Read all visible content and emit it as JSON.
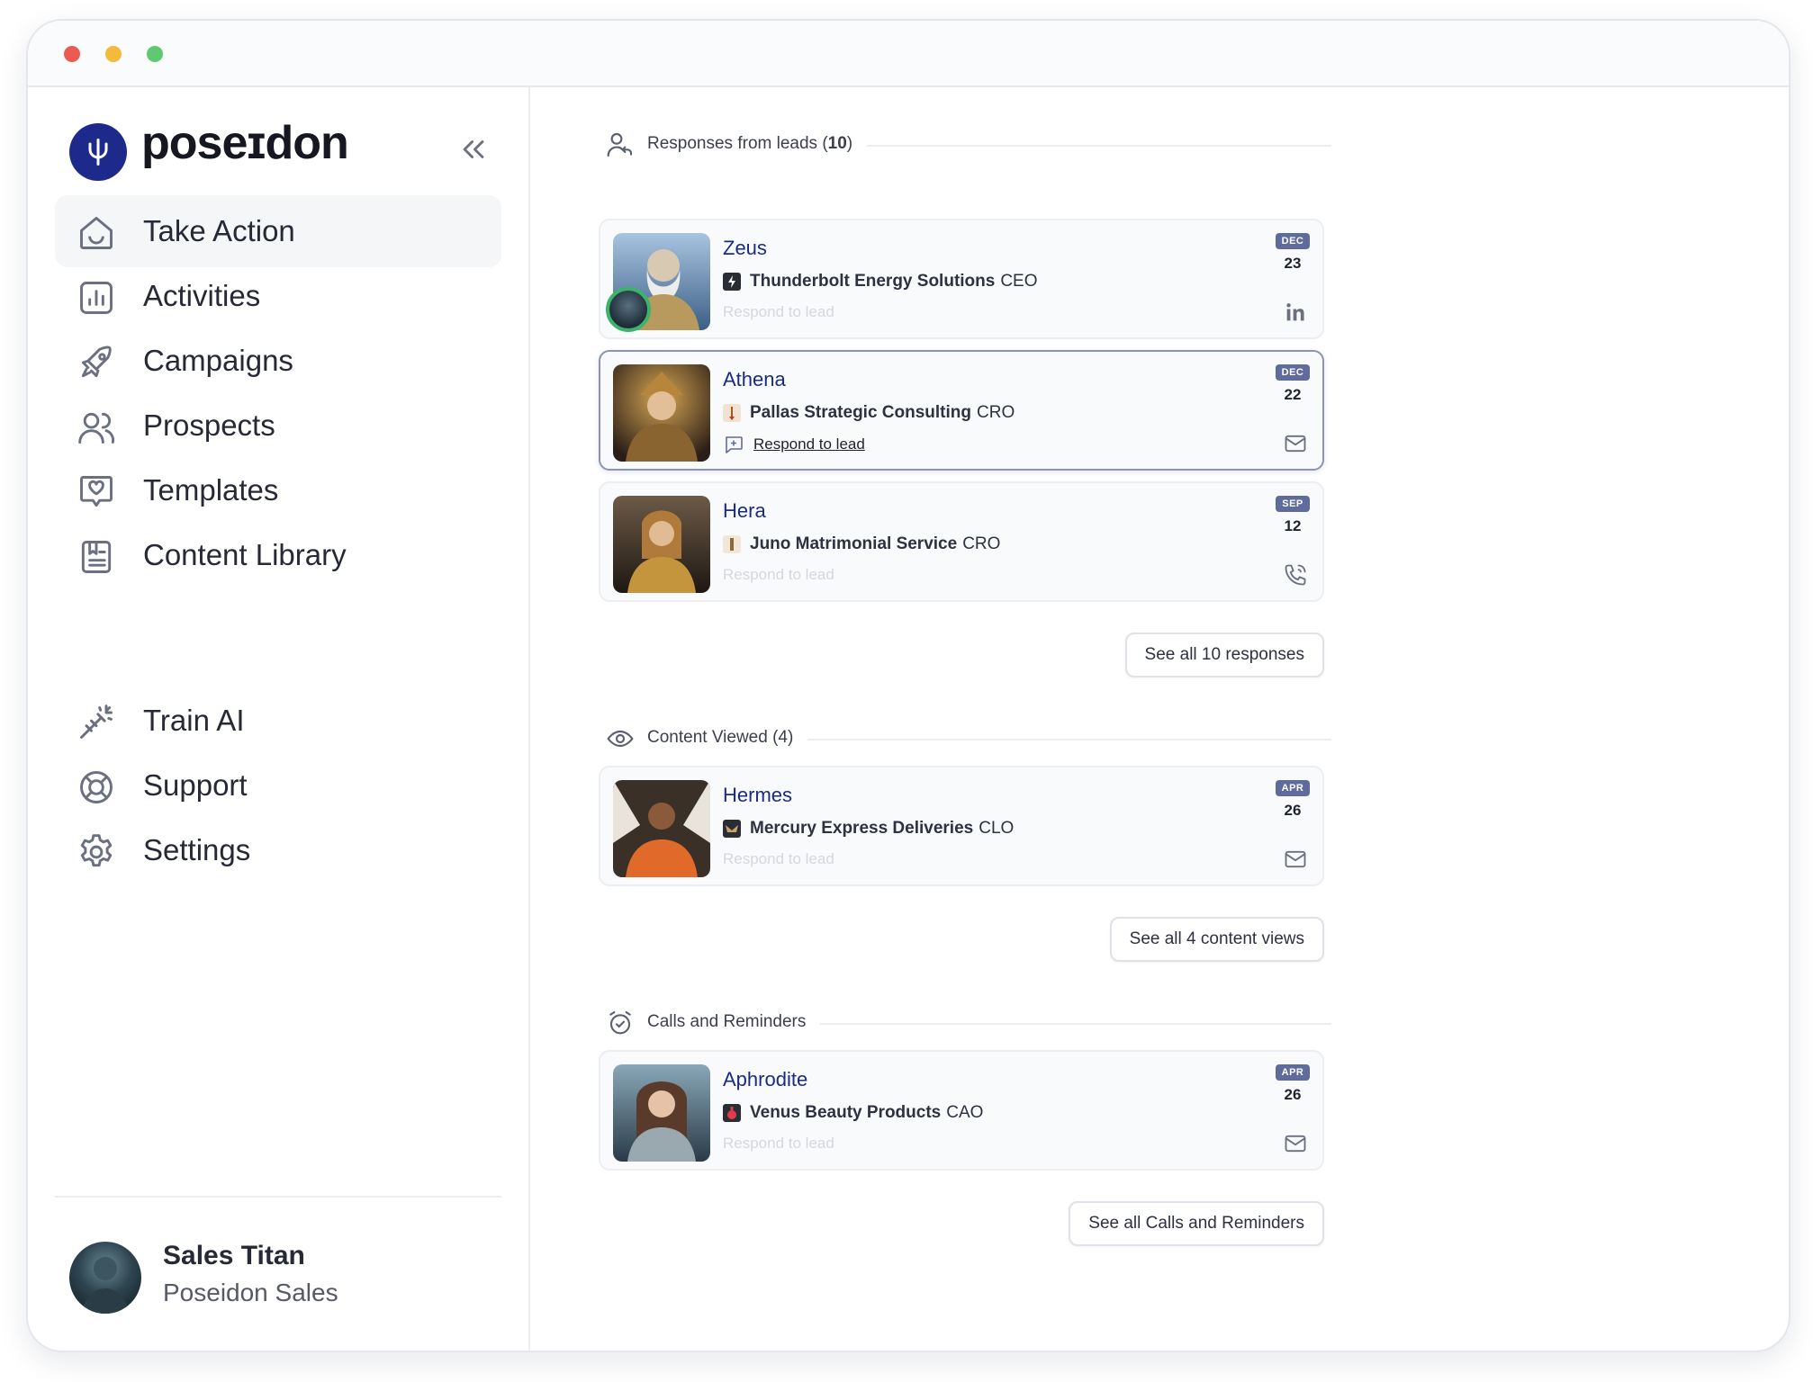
{
  "brand": {
    "name": "poseɪdon"
  },
  "nav": {
    "main": [
      {
        "label": "Take Action",
        "icon": "home-icon",
        "active": true
      },
      {
        "label": "Activities",
        "icon": "chart-icon"
      },
      {
        "label": "Campaigns",
        "icon": "rocket-icon"
      },
      {
        "label": "Prospects",
        "icon": "users-icon"
      },
      {
        "label": "Templates",
        "icon": "heart-message-icon"
      },
      {
        "label": "Content Library",
        "icon": "library-icon"
      }
    ],
    "secondary": [
      {
        "label": "Train AI",
        "icon": "magic-wand-icon"
      },
      {
        "label": "Support",
        "icon": "lifebuoy-icon"
      },
      {
        "label": "Settings",
        "icon": "gear-icon"
      }
    ]
  },
  "user": {
    "name": "Sales Titan",
    "org": "Poseidon Sales"
  },
  "sections": {
    "responses": {
      "title_prefix": "Responses from leads (",
      "count": "10",
      "title_suffix": ")",
      "see_all": "See all 10 responses"
    },
    "content": {
      "title": "Content Viewed (4)",
      "see_all": "See all 4 content views"
    },
    "calls": {
      "title": "Calls and Reminders",
      "see_all": "See all Calls and Reminders"
    }
  },
  "leads": [
    {
      "name": "Zeus",
      "company": "Thunderbolt Energy Solutions",
      "role": "CEO",
      "respond": "Respond to lead",
      "month": "DEC",
      "day": "23",
      "channel": "linkedin-icon"
    },
    {
      "name": "Athena",
      "company": "Pallas Strategic Consulting",
      "role": "CRO",
      "respond": "Respond to lead",
      "month": "DEC",
      "day": "22",
      "channel": "mail-icon"
    },
    {
      "name": "Hera",
      "company": "Juno Matrimonial Service",
      "role": "CRO",
      "respond": "Respond to lead",
      "month": "SEP",
      "day": "12",
      "channel": "phone-icon"
    },
    {
      "name": "Hermes",
      "company": "Mercury Express Deliveries",
      "role": "CLO",
      "respond": "Respond to lead",
      "month": "APR",
      "day": "26",
      "channel": "mail-icon"
    },
    {
      "name": "Aphrodite",
      "company": "Venus Beauty Products",
      "role": "CAO",
      "respond": "Respond to lead",
      "month": "APR",
      "day": "26",
      "channel": "mail-icon"
    }
  ],
  "colors": {
    "accent": "#1d2a8c",
    "lead_name": "#1a2a86",
    "online": "#3bb36a",
    "date_badge": "#5f6b9d"
  }
}
